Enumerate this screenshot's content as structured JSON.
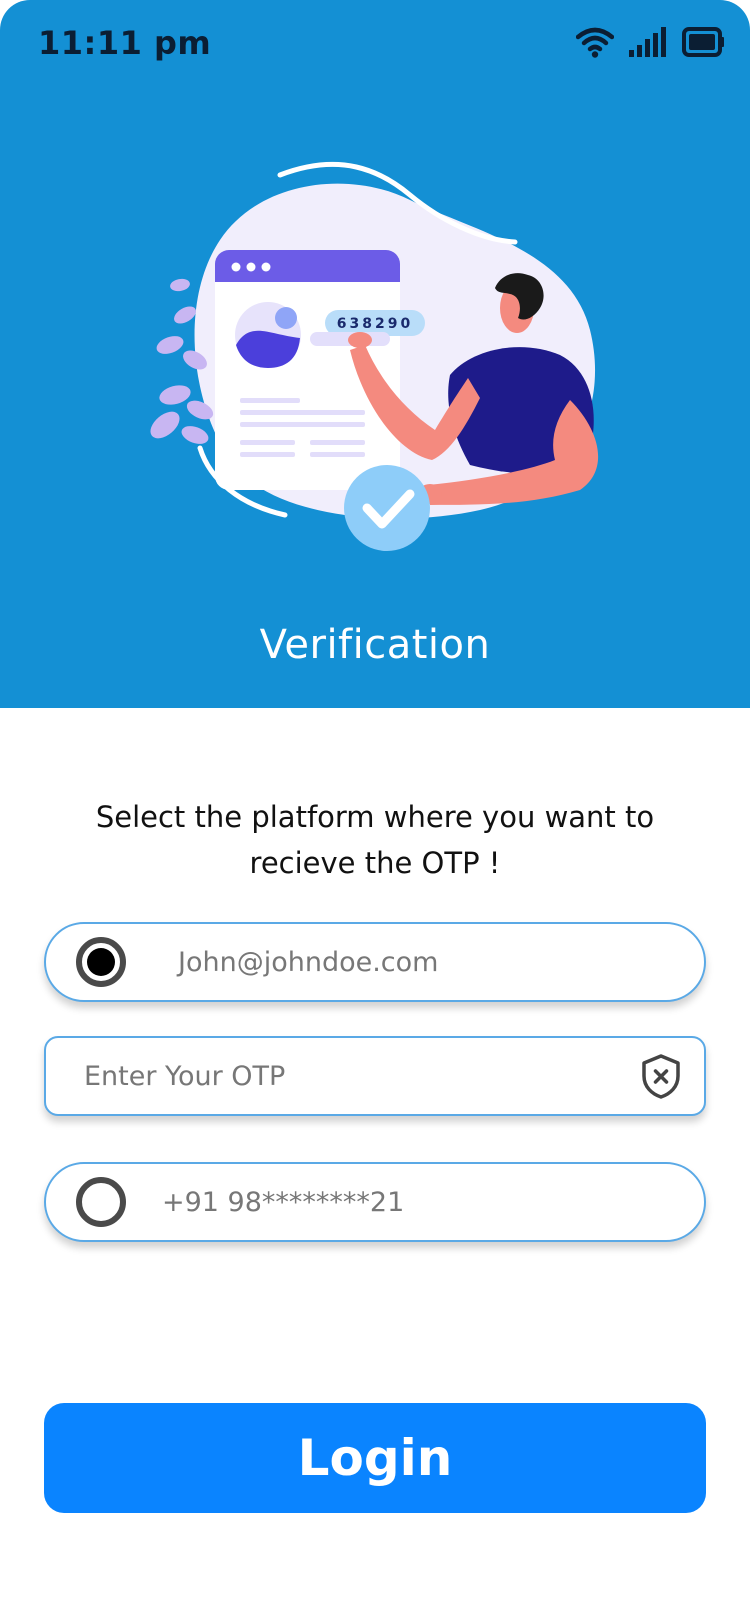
{
  "status_bar": {
    "time": "11:11 pm"
  },
  "header": {
    "title": "Verification",
    "illustration": {
      "otp_code": "638290"
    }
  },
  "instruction": "Select the platform where you want to recieve the OTP !",
  "options": {
    "email": {
      "value": "John@johndoe.com",
      "selected": true
    },
    "otp": {
      "placeholder": "Enter Your OTP"
    },
    "phone": {
      "value": "+91 98********21",
      "selected": false
    }
  },
  "login_button": {
    "label": "Login"
  },
  "colors": {
    "header_bg": "#1490D4",
    "button_bg": "#0A84FF",
    "field_border": "#5aa9e6"
  },
  "icons": [
    "wifi-icon",
    "signal-icon",
    "battery-icon",
    "shield-close-icon",
    "radio-checked-icon",
    "radio-unchecked-icon",
    "check-icon"
  ]
}
